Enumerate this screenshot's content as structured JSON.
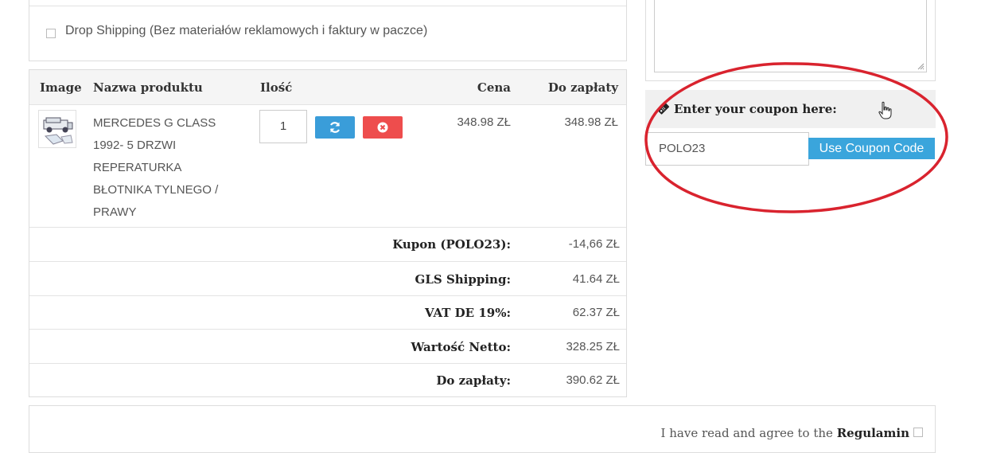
{
  "drop_shipping": {
    "label": "Drop Shipping (Bez materiałów reklamowych i faktury w paczce)"
  },
  "cart": {
    "headers": {
      "image": "Image",
      "name": "Nazwa produktu",
      "qty": "Ilość",
      "price": "Cena",
      "total": "Do zapłaty"
    },
    "item": {
      "name_lines": [
        "MERCEDES G CLASS",
        "1992- 5 DRZWI",
        "REPERATURKA",
        "BŁOTNIKA TYLNEGO /",
        "PRAWY"
      ],
      "qty": "1",
      "price": "348.98 ZŁ",
      "total": "348.98 ZŁ"
    },
    "totals": [
      {
        "label": "Kupon (POLO23):",
        "value": "-14,66 ZŁ"
      },
      {
        "label": "GLS Shipping:",
        "value": "41.64 ZŁ"
      },
      {
        "label": "VAT DE 19%:",
        "value": "62.37 ZŁ"
      },
      {
        "label": "Wartość Netto:",
        "value": "328.25 ZŁ"
      },
      {
        "label": "Do zapłaty:",
        "value": "390.62 ZŁ"
      }
    ]
  },
  "coupon": {
    "heading": "Enter your coupon here:",
    "value": "POLO23",
    "button": "Use Coupon Code"
  },
  "agreement": {
    "prefix": "I have read and agree to the ",
    "link": "Regulamin"
  },
  "colors": {
    "update_button": "#3a9dd9",
    "delete_button": "#ee4d4d",
    "coupon_button": "#3aa5dc",
    "highlight_ring": "#d9232e"
  },
  "icons": [
    "refresh-icon",
    "remove-icon",
    "ticket-icon",
    "hand-cursor-icon"
  ]
}
